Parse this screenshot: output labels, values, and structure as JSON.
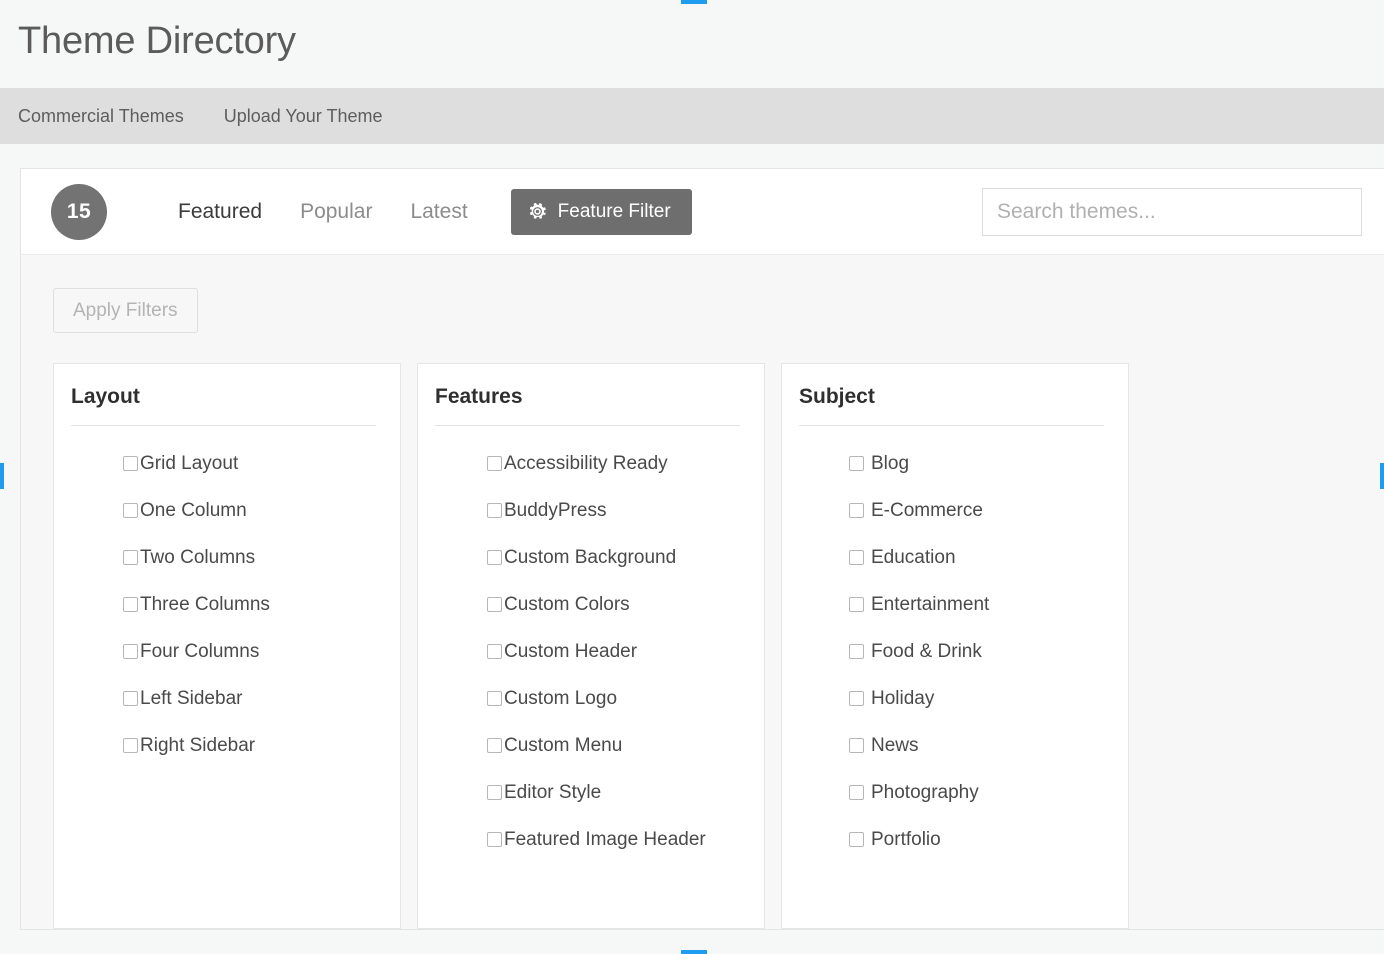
{
  "header": {
    "title": "Theme Directory"
  },
  "subnav": {
    "items": [
      {
        "label": "Commercial Themes"
      },
      {
        "label": "Upload Your Theme"
      }
    ]
  },
  "theme_navbar": {
    "count_badge": "15",
    "tabs": [
      {
        "label": "Featured",
        "active": true
      },
      {
        "label": "Popular",
        "active": false
      },
      {
        "label": "Latest",
        "active": false
      }
    ],
    "feature_filter": {
      "label": "Feature Filter",
      "icon": "gear-icon",
      "background_color": "#6e6e6e",
      "text_color": "#ffffff"
    },
    "search": {
      "placeholder": "Search themes...",
      "value": ""
    }
  },
  "filter_drawer": {
    "apply_filters_label": "Apply Filters",
    "apply_filters_disabled": true,
    "columns": [
      {
        "title": "Layout",
        "items": [
          {
            "label": "Grid Layout",
            "checked": false
          },
          {
            "label": "One Column",
            "checked": false
          },
          {
            "label": "Two Columns",
            "checked": false
          },
          {
            "label": "Three Columns",
            "checked": false
          },
          {
            "label": "Four Columns",
            "checked": false
          },
          {
            "label": "Left Sidebar",
            "checked": false
          },
          {
            "label": "Right Sidebar",
            "checked": false
          }
        ]
      },
      {
        "title": "Features",
        "items": [
          {
            "label": "Accessibility Ready",
            "checked": false
          },
          {
            "label": "BuddyPress",
            "checked": false
          },
          {
            "label": "Custom Background",
            "checked": false
          },
          {
            "label": "Custom Colors",
            "checked": false
          },
          {
            "label": "Custom Header",
            "checked": false
          },
          {
            "label": "Custom Logo",
            "checked": false
          },
          {
            "label": "Custom Menu",
            "checked": false
          },
          {
            "label": "Editor Style",
            "checked": false
          },
          {
            "label": "Featured Image Header",
            "checked": false
          }
        ]
      },
      {
        "title": "Subject",
        "items": [
          {
            "label": "Blog",
            "checked": false
          },
          {
            "label": "E-Commerce",
            "checked": false
          },
          {
            "label": "Education",
            "checked": false
          },
          {
            "label": "Entertainment",
            "checked": false
          },
          {
            "label": "Food & Drink",
            "checked": false
          },
          {
            "label": "Holiday",
            "checked": false
          },
          {
            "label": "News",
            "checked": false
          },
          {
            "label": "Photography",
            "checked": false
          },
          {
            "label": "Portfolio",
            "checked": false
          }
        ]
      }
    ]
  },
  "colors": {
    "page_background": "#f6f7f7",
    "subnav_background": "#dedede",
    "panel_background": "#ffffff",
    "drawer_background": "#f7f7f7",
    "accent_gray": "#6e6e6e",
    "selection_marker": "#1e9cf0"
  }
}
